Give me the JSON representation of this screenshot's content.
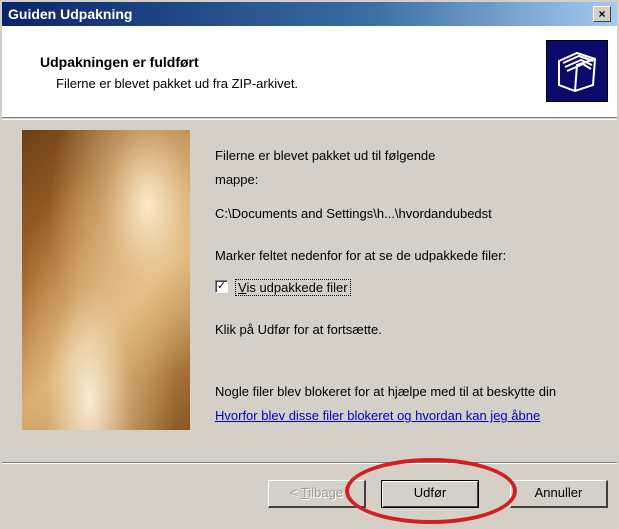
{
  "window": {
    "title": "Guiden Udpakning",
    "close_label": "×"
  },
  "header": {
    "title": "Udpakningen er fuldført",
    "subtitle": "Filerne er blevet pakket ud fra ZIP-arkivet."
  },
  "content": {
    "line1": "Filerne er blevet pakket ud til følgende",
    "line2": "mappe:",
    "path": "C:\\Documents and Settings\\h...\\hvordandubedst",
    "instruction": "Marker feltet nedenfor for at se de udpakkede filer:",
    "checkbox": {
      "checked": true,
      "mark": "✓",
      "label_first": "V",
      "label_rest": "is udpakkede filer"
    },
    "continue_text": "Klik på Udfør for at fortsætte.",
    "blocked_text": "Nogle filer blev blokeret for at hjælpe med til at beskytte din",
    "blocked_link": "Hvorfor blev disse filer blokeret og hvordan kan jeg åbne"
  },
  "buttons": {
    "back_prefix": "< ",
    "back_u": "T",
    "back_rest": "ilbage",
    "finish": "Udfør",
    "cancel": "Annuller"
  },
  "colors": {
    "titlebar_start": "#0a246a",
    "titlebar_end": "#a6caf0",
    "dialog_bg": "#d4d0c8",
    "link": "#0000cc",
    "annotation_circle": "#d22020"
  },
  "icons": {
    "header": "folders-icon",
    "close": "close-icon",
    "check": "checkmark-icon"
  }
}
